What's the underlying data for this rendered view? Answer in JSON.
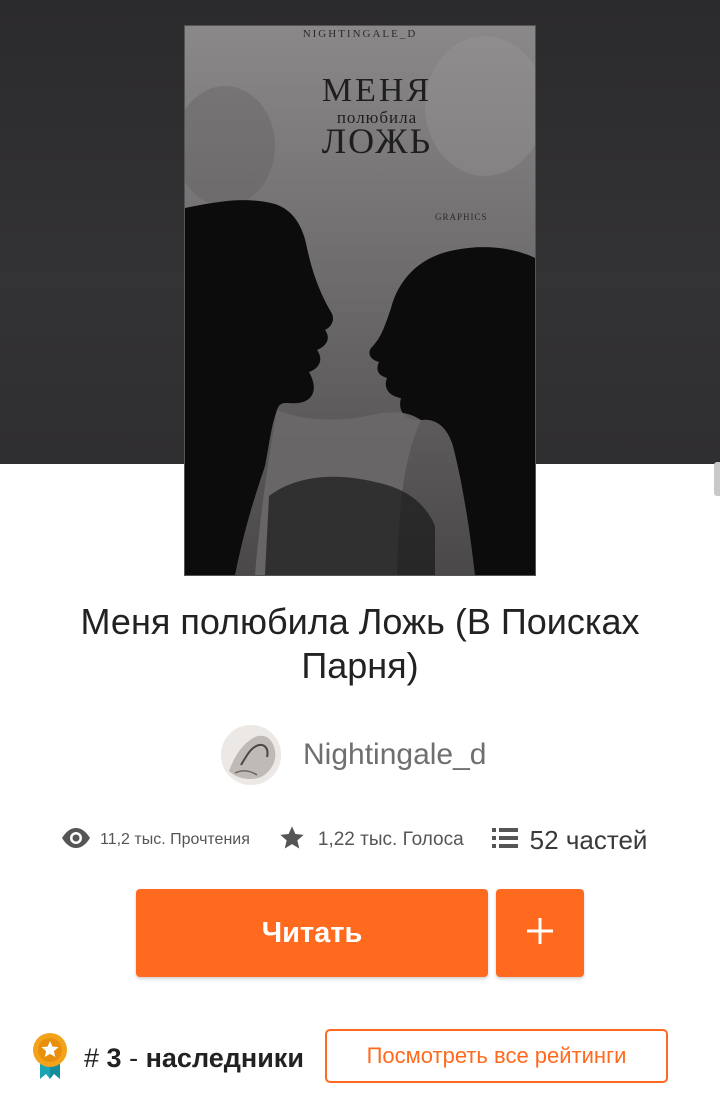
{
  "cover": {
    "author_mark": "NIGHTINGALE_D",
    "title_line1": "МЕНЯ",
    "title_line2": "полюбила",
    "title_line3": "ЛОЖЬ",
    "graphics_mark": "GRAPHICS"
  },
  "story": {
    "title": "Меня полюбила Ложь (В Поисках Парня)",
    "author": "Nightingale_d"
  },
  "stats": {
    "reads": "11,2 тыс. Прочтения",
    "votes": "1,22 тыс. Голоса",
    "parts": "52 частей"
  },
  "actions": {
    "read_label": "Читать",
    "add_label": "+"
  },
  "ranking": {
    "hash": "#",
    "rank": "3",
    "separator": "-",
    "tag": "наследники",
    "view_all_label": "Посмотреть все рейтинги"
  },
  "colors": {
    "accent": "#ff6a1e",
    "hero_background": "#2f2e30",
    "text": "#222222",
    "muted": "#6f6f6f"
  },
  "icons": {
    "reads": "eye-icon",
    "votes": "star-icon",
    "parts": "list-icon",
    "add": "plus-icon",
    "rank": "medal-icon"
  }
}
